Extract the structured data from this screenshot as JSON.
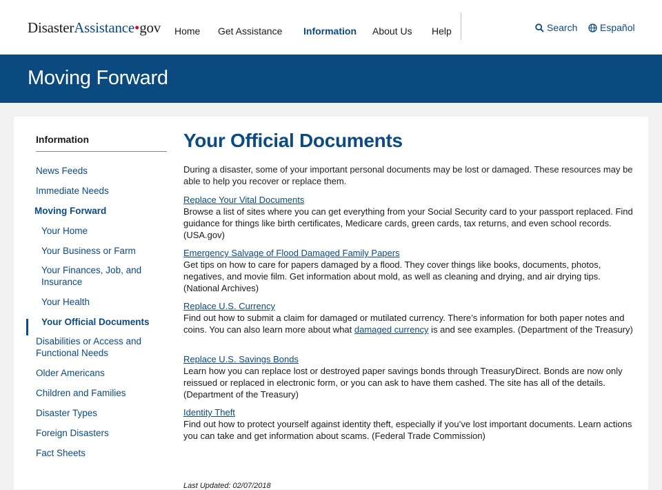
{
  "header": {
    "logo_main": "Disaster",
    "logo_accent": "Assistance",
    "logo_dot": "•",
    "logo_tld": "gov",
    "nav": [
      {
        "label": "Home"
      },
      {
        "label": "Get Assistance"
      },
      {
        "label": "Information"
      },
      {
        "label": "About Us"
      },
      {
        "label": "Help"
      }
    ],
    "search_label": "Search",
    "espanol_label": "Español"
  },
  "banner": {
    "title": "Moving Forward"
  },
  "sidebar": {
    "heading": "Information",
    "items": [
      {
        "label": "News Feeds"
      },
      {
        "label": "Immediate Needs"
      },
      {
        "label": "Moving Forward"
      },
      {
        "label": "Your Home"
      },
      {
        "label": "Your Business or Farm"
      },
      {
        "label": "Your Finances, Job, and Insurance"
      },
      {
        "label": "Your Health"
      },
      {
        "label": "Your Official Documents"
      },
      {
        "label": "Disabilities or Access and Functional Needs"
      },
      {
        "label": "Older Americans"
      },
      {
        "label": "Children and Families"
      },
      {
        "label": "Disaster Types"
      },
      {
        "label": "Foreign Disasters"
      },
      {
        "label": "Fact Sheets"
      }
    ]
  },
  "main": {
    "title": "Your Official Documents",
    "intro": "During a disaster, some of your important personal documents may be lost or damaged. These resources may be able to help you recover or replace them.",
    "resources": [
      {
        "link": "Replace Your Vital Documents",
        "desc": "Browse a list of sites where you can get everything from your Social Security card to your passport replaced. Find guidance for things like birth certificates, Medicare cards, green cards, tax returns, and even school records. (USA.gov)"
      },
      {
        "link": "Emergency Salvage of Flood Damaged Family Papers",
        "desc": "Get tips on how to care for papers damaged by a flood. They cover things like books, documents, photos, negatives, and movie film. Get information about mold, as well as cleaning and drying, and air drying tips. (National Archives)"
      },
      {
        "link": "Replace U.S. Currency",
        "desc_before": "Find out how to submit a claim for damaged or mutilated currency. There’s information for both paper notes and coins. You can also learn more about what ",
        "inline_link": "damaged currency",
        "desc_after": " is and see examples. (Department of the Treasury)"
      },
      {
        "link": "Replace U.S. Savings Bonds",
        "desc": "Learn how you can replace lost or destroyed paper savings bonds through TreasuryDirect. Bonds are now only reissued or replaced in electronic form, or you can ask to have them cashed. The site has all of the details. (Department of the Treasury)"
      },
      {
        "link": "Identity Theft",
        "desc": "Find out how to protect yourself against identity theft, especially if you’ve lost important documents. Learn actions you can take and get information about scams. (Federal Trade Commission)"
      }
    ],
    "last_updated": "Last Updated: 02/07/2018"
  },
  "colors": {
    "brand_blue": "#0b4a82",
    "banner_blue": "#0b4a7e",
    "logo_dot_red": "#c8102e",
    "page_bg": "#f1f1f1"
  }
}
